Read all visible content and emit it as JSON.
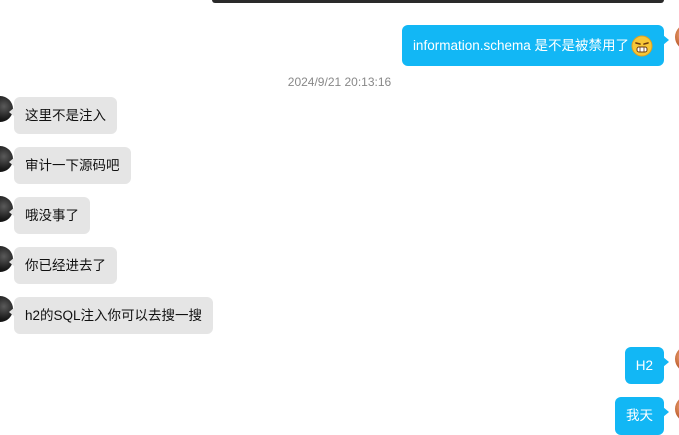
{
  "timestamp": "2024/9/21 20:13:16",
  "messages": [
    {
      "side": "out",
      "text": "information.schema 是不是被禁用了",
      "emoji": "grimace-emoji-icon"
    },
    {
      "side": "in",
      "text": "这里不是注入"
    },
    {
      "side": "in",
      "text": "审计一下源码吧"
    },
    {
      "side": "in",
      "text": "哦没事了"
    },
    {
      "side": "in",
      "text": "你已经进去了"
    },
    {
      "side": "in",
      "text": "h2的SQL注入你可以去搜一搜"
    },
    {
      "side": "out",
      "text": "H2"
    },
    {
      "side": "out",
      "text": "我天"
    }
  ],
  "colors": {
    "outgoing_bubble": "#12b7f5",
    "incoming_bubble": "#e5e5e5",
    "timestamp_text": "#888888"
  }
}
